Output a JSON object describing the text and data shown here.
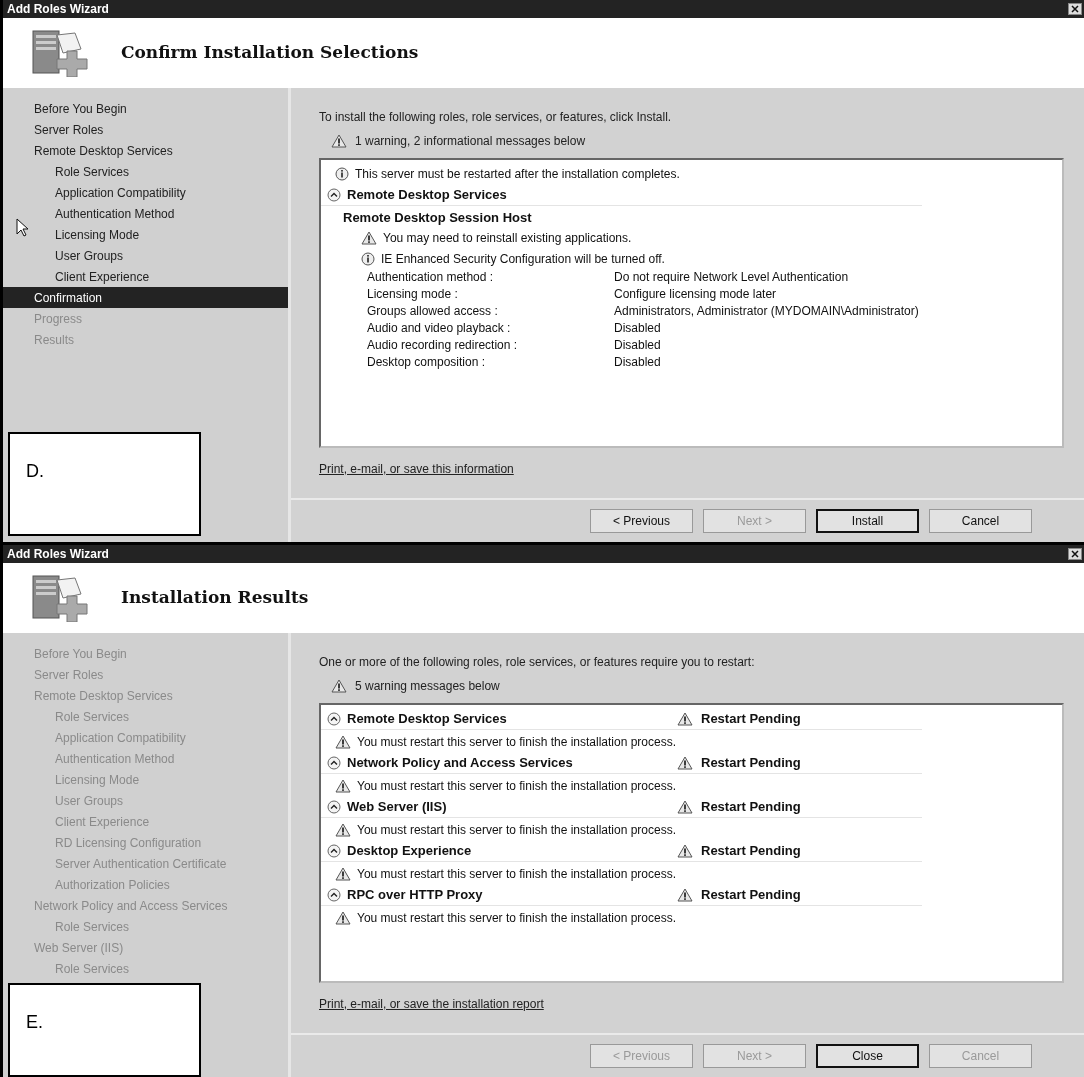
{
  "windows": [
    {
      "title": "Add Roles Wizard",
      "heading": "Confirm Installation Selections",
      "caption": "D.",
      "cursor": true,
      "sidebar": [
        {
          "text": "Before You Begin",
          "selected": false,
          "disabled": false
        },
        {
          "text": "Server Roles",
          "selected": false,
          "disabled": false
        },
        {
          "text": "Remote Desktop Services",
          "selected": false,
          "disabled": false,
          "children": [
            {
              "text": "Role Services",
              "selected": false,
              "disabled": false
            },
            {
              "text": "Application Compatibility",
              "selected": false,
              "disabled": false
            },
            {
              "text": "Authentication Method",
              "selected": false,
              "disabled": false
            },
            {
              "text": "Licensing Mode",
              "selected": false,
              "disabled": false
            },
            {
              "text": "User Groups",
              "selected": false,
              "disabled": false
            },
            {
              "text": "Client Experience",
              "selected": false,
              "disabled": false
            }
          ]
        },
        {
          "text": "Confirmation",
          "selected": true,
          "disabled": false
        },
        {
          "text": "Progress",
          "selected": false,
          "disabled": true
        },
        {
          "text": "Results",
          "selected": false,
          "disabled": true
        }
      ],
      "intro": "To install the following roles, role services, or features, click Install.",
      "summary": "1 warning, 2 informational messages below",
      "entries": [
        {
          "kind": "info",
          "text": "This server must be restarted after the installation completes."
        },
        {
          "kind": "section",
          "name": "Remote Desktop Services",
          "expanded": true
        },
        {
          "kind": "subheading",
          "text": "Remote Desktop Session Host",
          "children": [
            {
              "kind": "warning",
              "text": "You may need to reinstall existing applications."
            },
            {
              "kind": "info",
              "text": "IE Enhanced Security Configuration will be turned off."
            },
            {
              "kind": "property",
              "label": "Authentication method :",
              "value": "Do not require Network Level Authentication"
            },
            {
              "kind": "property",
              "label": "Licensing mode :",
              "value": "Configure licensing mode later"
            },
            {
              "kind": "property",
              "label": "Groups allowed access :",
              "value": "Administrators, Administrator (MYDOMAIN\\Administrator)"
            },
            {
              "kind": "property",
              "label": "Audio and video playback :",
              "value": "Disabled"
            },
            {
              "kind": "property",
              "label": "Audio recording redirection :",
              "value": "Disabled"
            },
            {
              "kind": "property",
              "label": "Desktop composition :",
              "value": "Disabled"
            }
          ]
        }
      ],
      "link": "Print, e-mail, or save this information",
      "buttons": [
        {
          "label": "< Previous",
          "disabled": false,
          "default": false
        },
        {
          "label": "Next >",
          "disabled": true,
          "default": false
        },
        {
          "label": "Install",
          "disabled": false,
          "default": true
        },
        {
          "label": "Cancel",
          "disabled": false,
          "default": false
        }
      ]
    },
    {
      "title": "Add Roles Wizard",
      "heading": "Installation Results",
      "caption": "E.",
      "cursor": false,
      "sidebar": [
        {
          "text": "Before You Begin",
          "selected": false,
          "disabled": true
        },
        {
          "text": "Server Roles",
          "selected": false,
          "disabled": true
        },
        {
          "text": "Remote Desktop Services",
          "selected": false,
          "disabled": true,
          "children": [
            {
              "text": "Role Services",
              "selected": false,
              "disabled": true
            },
            {
              "text": "Application Compatibility",
              "selected": false,
              "disabled": true
            },
            {
              "text": "Authentication Method",
              "selected": false,
              "disabled": true
            },
            {
              "text": "Licensing Mode",
              "selected": false,
              "disabled": true
            },
            {
              "text": "User Groups",
              "selected": false,
              "disabled": true
            },
            {
              "text": "Client Experience",
              "selected": false,
              "disabled": true
            },
            {
              "text": "RD Licensing Configuration",
              "selected": false,
              "disabled": true
            },
            {
              "text": "Server Authentication Certificate",
              "selected": false,
              "disabled": true
            },
            {
              "text": "Authorization Policies",
              "selected": false,
              "disabled": true
            }
          ]
        },
        {
          "text": "Network Policy and Access Services",
          "selected": false,
          "disabled": true,
          "children": [
            {
              "text": "Role Services",
              "selected": false,
              "disabled": true
            }
          ]
        },
        {
          "text": "Web Server (IIS)",
          "selected": false,
          "disabled": true,
          "children": [
            {
              "text": "Role Services",
              "selected": false,
              "disabled": true
            }
          ]
        }
      ],
      "intro": "One or more of the following roles, role services, or features require you to restart:",
      "summary": "5 warning messages below",
      "entries": [
        {
          "kind": "section",
          "name": "Remote Desktop Services",
          "expanded": true,
          "status": "Restart Pending"
        },
        {
          "kind": "warning",
          "text": "You must restart this server to finish the installation process."
        },
        {
          "kind": "section",
          "name": "Network Policy and Access Services",
          "expanded": true,
          "status": "Restart Pending"
        },
        {
          "kind": "warning",
          "text": "You must restart this server to finish the installation process."
        },
        {
          "kind": "section",
          "name": "Web Server (IIS)",
          "expanded": true,
          "status": "Restart Pending"
        },
        {
          "kind": "warning",
          "text": "You must restart this server to finish the installation process."
        },
        {
          "kind": "section",
          "name": "Desktop Experience",
          "expanded": true,
          "status": "Restart Pending"
        },
        {
          "kind": "warning",
          "text": "You must restart this server to finish the installation process."
        },
        {
          "kind": "section",
          "name": "RPC over HTTP Proxy",
          "expanded": true,
          "status": "Restart Pending"
        },
        {
          "kind": "warning",
          "text": "You must restart this server to finish the installation process."
        }
      ],
      "link": "Print, e-mail, or save the installation report",
      "buttons": [
        {
          "label": "< Previous",
          "disabled": true,
          "default": false
        },
        {
          "label": "Next >",
          "disabled": true,
          "default": false
        },
        {
          "label": "Close",
          "disabled": false,
          "default": true
        },
        {
          "label": "Cancel",
          "disabled": true,
          "default": false
        }
      ]
    }
  ]
}
